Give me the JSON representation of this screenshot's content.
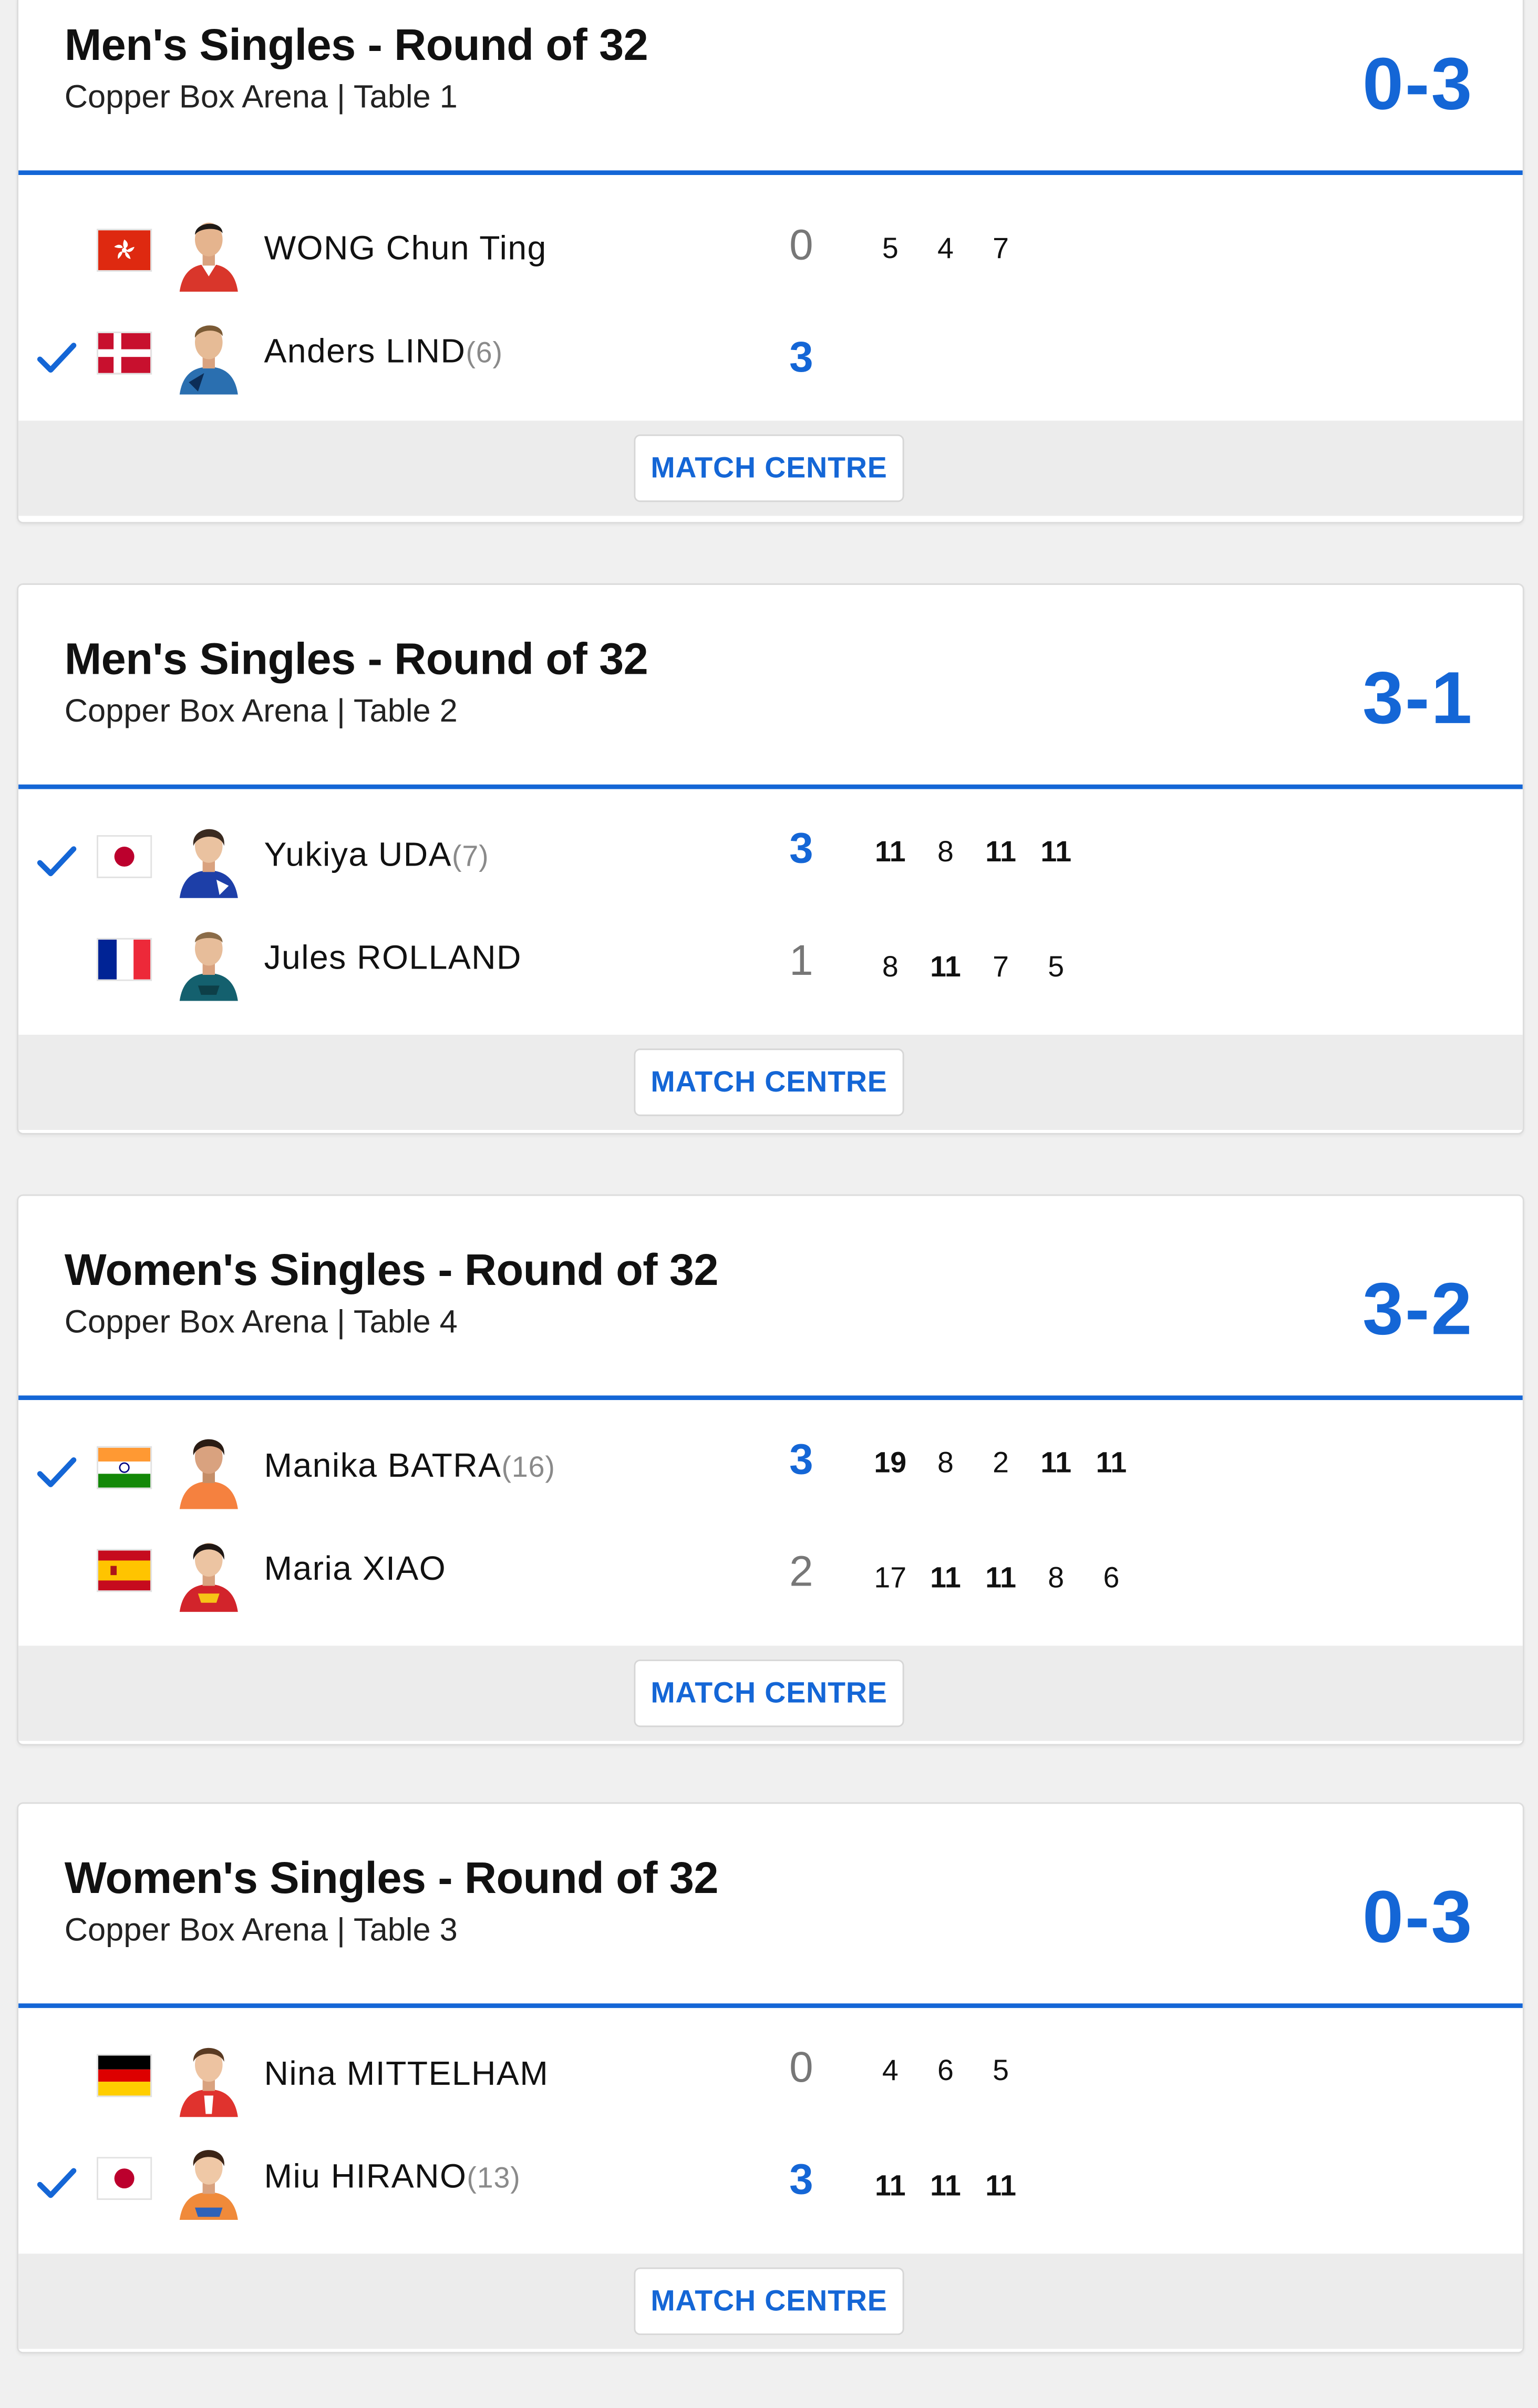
{
  "matches": [
    {
      "title": "Men's Singles - Round of 32",
      "venue": "Copper Box Arena | Table 1",
      "score": "0-3",
      "players": [
        {
          "name": "WONG Chun Ting",
          "seed": "",
          "flag": "hong-kong-flag",
          "total": "0",
          "winner": false,
          "games": [
            "5",
            "4",
            "7"
          ],
          "game_wins": [
            false,
            false,
            false
          ]
        },
        {
          "name": "Anders LIND",
          "seed": "(6)",
          "flag": "denmark-flag",
          "total": "3",
          "winner": true,
          "games": [],
          "game_wins": []
        }
      ],
      "button": "MATCH CENTRE"
    },
    {
      "title": "Men's Singles - Round of 32",
      "venue": "Copper Box Arena | Table 2",
      "score": "3-1",
      "players": [
        {
          "name": "Yukiya UDA",
          "seed": "(7)",
          "flag": "japan-flag",
          "total": "3",
          "winner": true,
          "games": [
            "11",
            "8",
            "11",
            "11"
          ],
          "game_wins": [
            true,
            false,
            true,
            true
          ]
        },
        {
          "name": "Jules ROLLAND",
          "seed": "",
          "flag": "france-flag",
          "total": "1",
          "winner": false,
          "games": [
            "8",
            "11",
            "7",
            "5"
          ],
          "game_wins": [
            false,
            true,
            false,
            false
          ]
        }
      ],
      "button": "MATCH CENTRE"
    },
    {
      "title": "Women's Singles - Round of 32",
      "venue": "Copper Box Arena | Table 4",
      "score": "3-2",
      "players": [
        {
          "name": "Manika BATRA",
          "seed": "(16)",
          "flag": "india-flag",
          "total": "3",
          "winner": true,
          "games": [
            "19",
            "8",
            "2",
            "11",
            "11"
          ],
          "game_wins": [
            true,
            false,
            false,
            true,
            true
          ]
        },
        {
          "name": "Maria XIAO",
          "seed": "",
          "flag": "spain-flag",
          "total": "2",
          "winner": false,
          "games": [
            "17",
            "11",
            "11",
            "8",
            "6"
          ],
          "game_wins": [
            false,
            true,
            true,
            false,
            false
          ]
        }
      ],
      "button": "MATCH CENTRE"
    },
    {
      "title": "Women's Singles - Round of 32",
      "venue": "Copper Box Arena | Table 3",
      "score": "0-3",
      "players": [
        {
          "name": "Nina MITTELHAM",
          "seed": "",
          "flag": "germany-flag",
          "total": "0",
          "winner": false,
          "games": [
            "4",
            "6",
            "5"
          ],
          "game_wins": [
            false,
            false,
            false
          ]
        },
        {
          "name": "Miu HIRANO",
          "seed": "(13)",
          "flag": "japan-flag",
          "total": "3",
          "winner": true,
          "games": [
            "11",
            "11",
            "11"
          ],
          "game_wins": [
            true,
            true,
            true
          ]
        }
      ],
      "button": "MATCH CENTRE"
    }
  ],
  "colors": {
    "accent": "#1466d6",
    "loser_total": "#777777",
    "seed": "#8a8a8a"
  },
  "icons": [
    "winner-check-icon",
    "player-avatar"
  ]
}
